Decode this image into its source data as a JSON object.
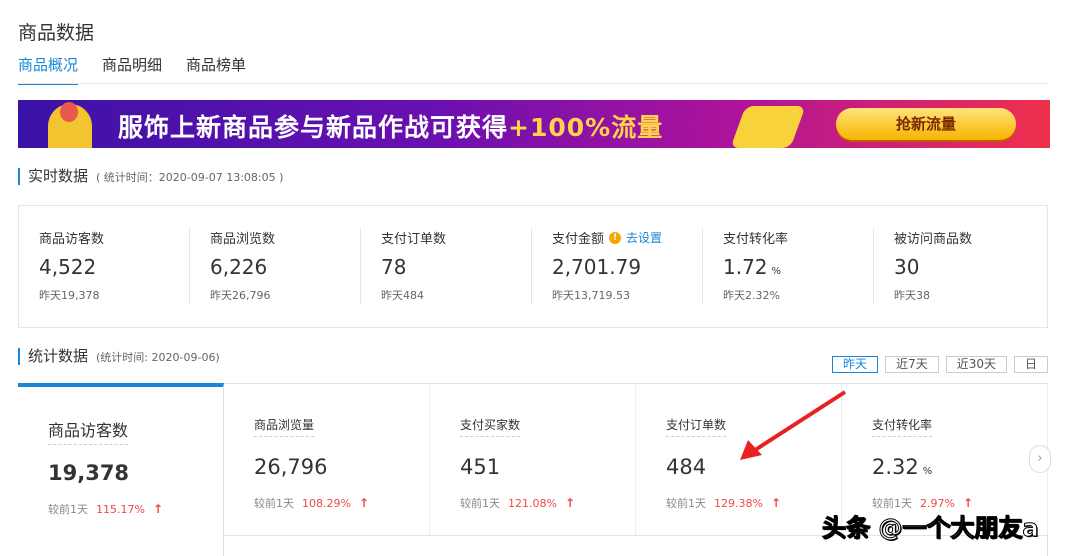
{
  "title": "商品数据",
  "tabs": [
    "商品概况",
    "商品明细",
    "商品榜单"
  ],
  "banner": {
    "text": "服饰上新商品参与新品作战可获得",
    "highlight": "+100%流量",
    "button": "抢新流量"
  },
  "realtime": {
    "heading": "实时数据",
    "subtitle": "( 统计时间：2020-09-07 13:08:05 )",
    "metrics": [
      {
        "label": "商品访客数",
        "value": "4,522",
        "unit": "",
        "yesterday": "昨天19,378"
      },
      {
        "label": "商品浏览数",
        "value": "6,226",
        "unit": "",
        "yesterday": "昨天26,796"
      },
      {
        "label": "支付订单数",
        "value": "78",
        "unit": "",
        "yesterday": "昨天484"
      },
      {
        "label": "支付金额",
        "value": "2,701.79",
        "unit": "",
        "yesterday": "昨天13,719.53",
        "link": "去设置"
      },
      {
        "label": "支付转化率",
        "value": "1.72",
        "unit": "%",
        "yesterday": "昨天2.32%"
      },
      {
        "label": "被访问商品数",
        "value": "30",
        "unit": "",
        "yesterday": "昨天38"
      }
    ]
  },
  "stats": {
    "heading": "统计数据",
    "subtitle": "(统计时间: 2020-09-06)",
    "ranges": [
      "昨天",
      "近7天",
      "近30天",
      "日"
    ],
    "cards": [
      {
        "label": "商品访客数",
        "value": "19,378",
        "unit": "",
        "cmp": "较前1天",
        "pct": "115.17%"
      },
      {
        "label": "商品浏览量",
        "value": "26,796",
        "unit": "",
        "cmp": "较前1天",
        "pct": "108.29%"
      },
      {
        "label": "支付买家数",
        "value": "451",
        "unit": "",
        "cmp": "较前1天",
        "pct": "121.08%"
      },
      {
        "label": "支付订单数",
        "value": "484",
        "unit": "",
        "cmp": "较前1天",
        "pct": "129.38%"
      },
      {
        "label": "支付转化率",
        "value": "2.32",
        "unit": "%",
        "cmp": "较前1天",
        "pct": "2.97%"
      }
    ]
  },
  "watermark": "头条 @一个大朋友a"
}
